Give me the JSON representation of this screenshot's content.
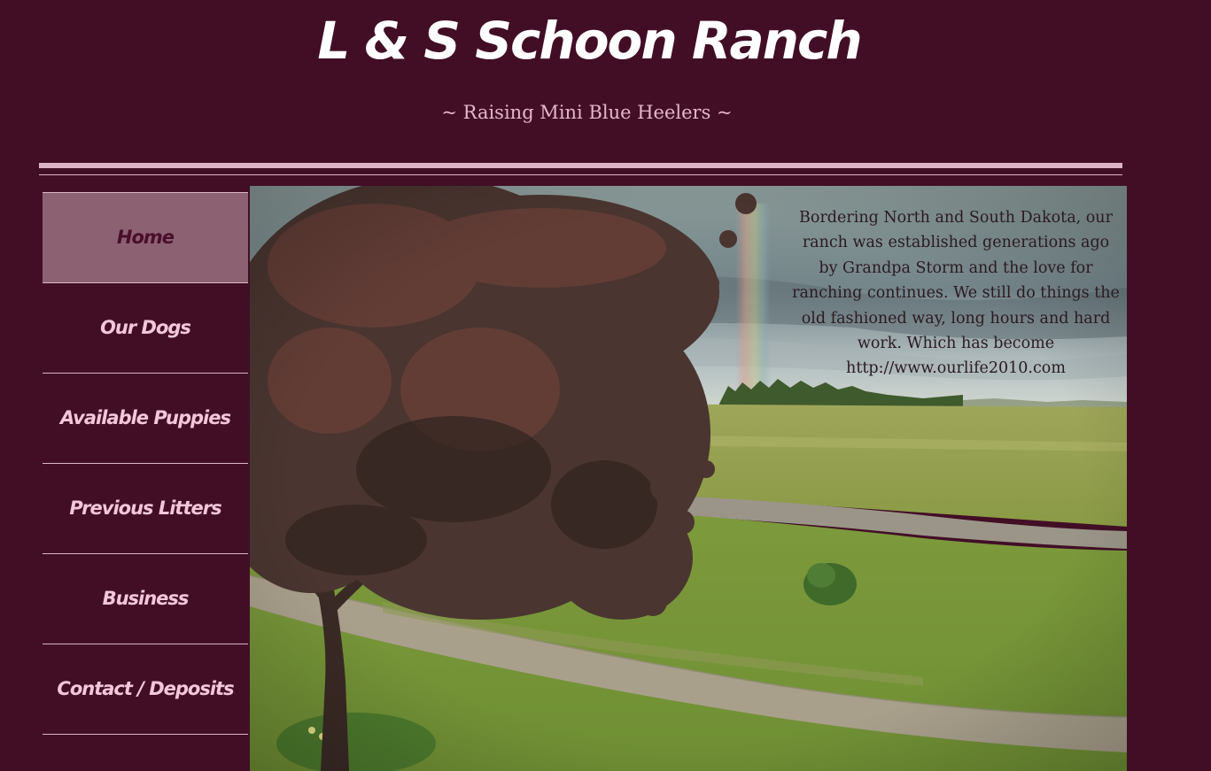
{
  "site": {
    "title": "L & S Schoon Ranch",
    "tagline": "~ Raising Mini Blue Heelers ~"
  },
  "nav": {
    "items": [
      {
        "label": "Home",
        "active": true
      },
      {
        "label": "Our Dogs",
        "active": false
      },
      {
        "label": "Available Puppies",
        "active": false
      },
      {
        "label": "Previous Litters",
        "active": false
      },
      {
        "label": "Business",
        "active": false
      },
      {
        "label": "Contact / Deposits",
        "active": false
      }
    ]
  },
  "hero": {
    "text": "Bordering North and South Dakota, our ranch was established generations ago by Grandpa Storm and the love for ranching continues. We still do things the old fashioned way, long hours and hard work. Which has become http://www.ourlife2010.com"
  },
  "colors": {
    "background": "#420e26",
    "accent": "#dcb3c7",
    "nav_active": "#8c6273"
  }
}
